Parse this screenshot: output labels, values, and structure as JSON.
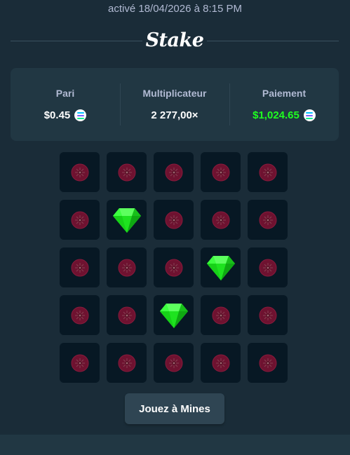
{
  "header": {
    "timestamp": "activé 18/04/2026 à 8:15 PM",
    "brand": "Stake"
  },
  "stats": {
    "bet": {
      "label": "Pari",
      "value": "$0.45",
      "icon": "solana-coin-icon"
    },
    "multiplier": {
      "label": "Multiplicateur",
      "value": "2 277,00×"
    },
    "payout": {
      "label": "Paiement",
      "value": "$1,024.65",
      "icon": "solana-coin-icon",
      "color": "#1fff20"
    }
  },
  "board": {
    "columns": 5,
    "tiles": [
      "mine",
      "mine",
      "mine",
      "mine",
      "mine",
      "mine",
      "gem",
      "mine",
      "mine",
      "mine",
      "mine",
      "mine",
      "mine",
      "gem",
      "mine",
      "mine",
      "mine",
      "gem",
      "mine",
      "mine",
      "mine",
      "mine",
      "mine",
      "mine",
      "mine"
    ]
  },
  "actions": {
    "play_label": "Jouez à Mines"
  },
  "colors": {
    "background": "#1a2c38",
    "panel": "#213743",
    "tile": "#071824",
    "gem": "#1fff20",
    "mine": "#7a1430"
  }
}
